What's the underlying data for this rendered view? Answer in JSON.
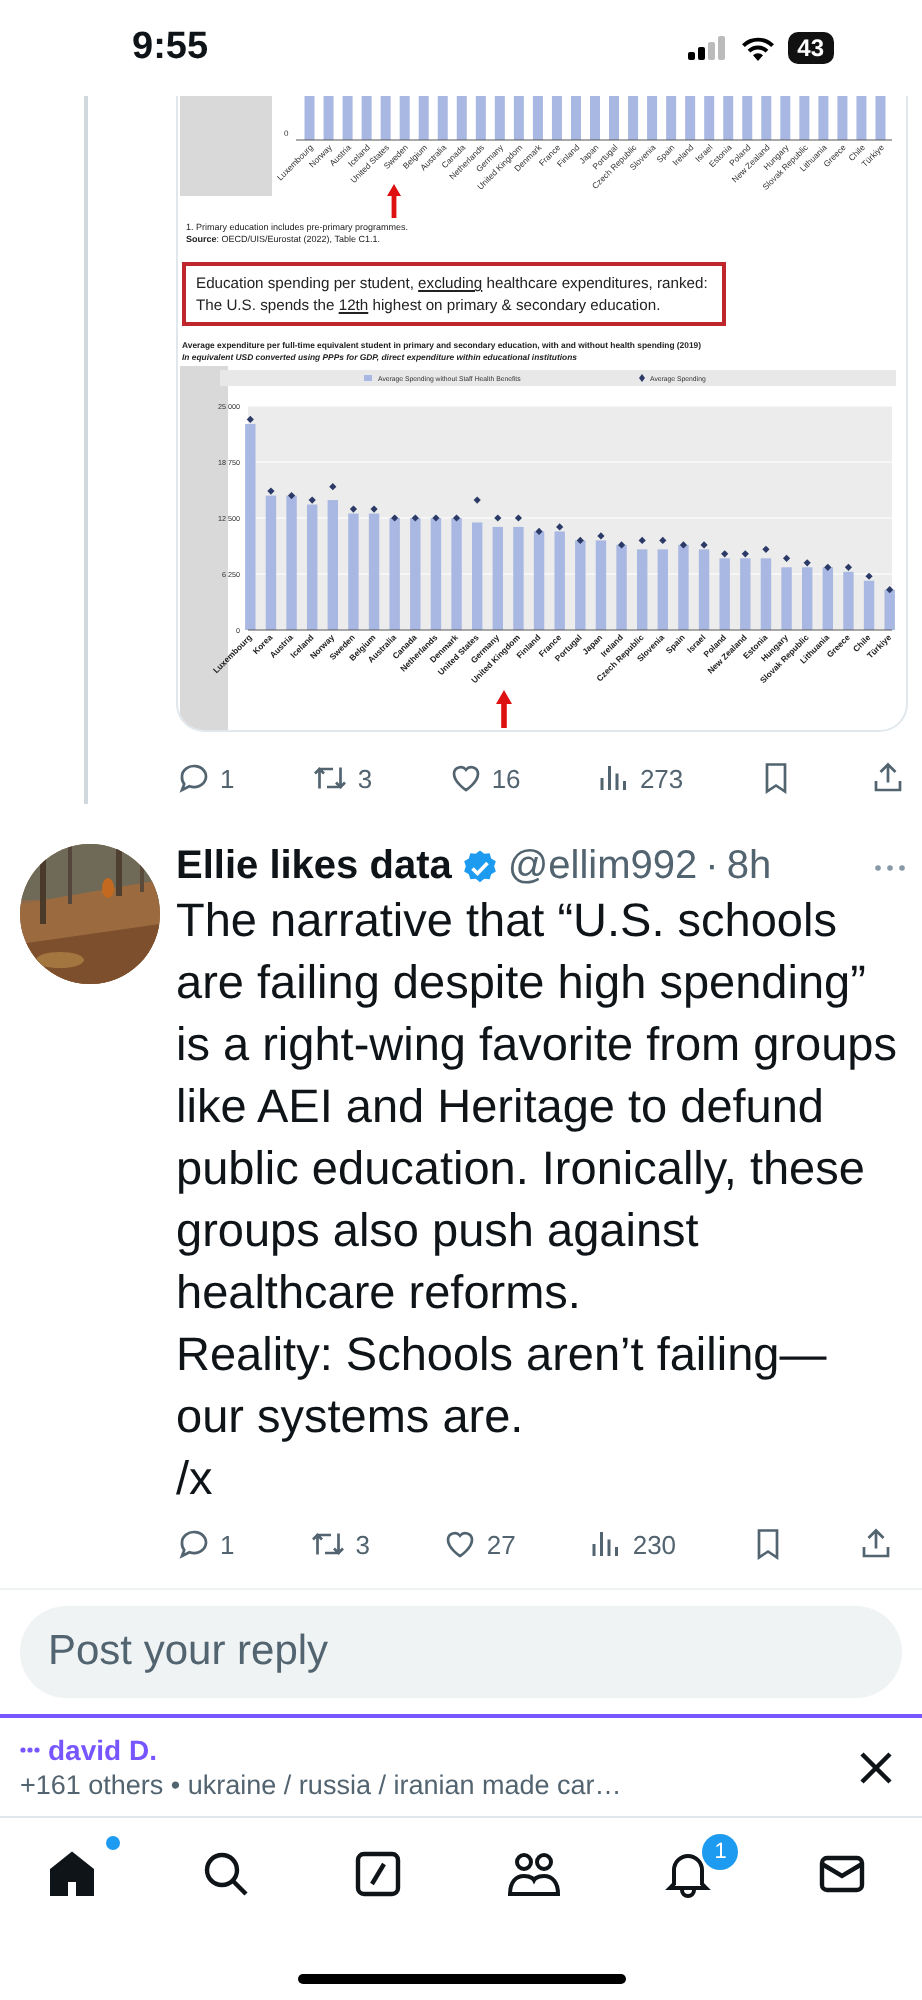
{
  "status_bar": {
    "time": "9:55",
    "battery": "43"
  },
  "quoted_image": {
    "top_chart": {
      "tick": "0",
      "labels": [
        "Luxembourg",
        "Norway",
        "Austria",
        "Iceland",
        "United States",
        "Sweden",
        "Belgium",
        "Australia",
        "Canada",
        "Netherlands",
        "Germany",
        "United Kingdom",
        "Denmark",
        "France",
        "Finland",
        "Japan",
        "Portugal",
        "Czech Republic",
        "Slovenia",
        "Spain",
        "Ireland",
        "Israel",
        "Estonia",
        "Poland",
        "New Zealand",
        "Hungary",
        "Slovak Republic",
        "Lithuania",
        "Greece",
        "Chile",
        "Türkiye"
      ]
    },
    "footnotes": [
      "1. Primary education includes pre-primary programmes.",
      "**Source**: OECD/UIS/Eurostat (2022), Table C1.1."
    ],
    "callout": [
      [
        {
          "text": "Education spending per student, ",
          "underline": false
        },
        {
          "text": "excluding",
          "underline": true
        },
        {
          "text": " healthcare expenditures, ranked:",
          "underline": false
        }
      ],
      [
        {
          "text": "The U.S. spends the ",
          "underline": false
        },
        {
          "text": "12th",
          "underline": true
        },
        {
          "text": " highest on primary & secondary education.",
          "underline": false
        }
      ]
    ],
    "chart_title": "Average expenditure per full-time equivalent student in primary and secondary education, with and without health spending (2019)",
    "chart_subtitle": "In equivalent USD converted using PPPs for GDP, direct expenditure within educational institutions",
    "chart_data": {
      "type": "bar",
      "stacked": false,
      "grid": true,
      "legend": "top",
      "ylim": [
        0,
        25000
      ],
      "yticks": [
        {
          "value": 0,
          "label": "0"
        },
        {
          "value": 6250,
          "label": "6 250"
        },
        {
          "value": 12500,
          "label": "12 500"
        },
        {
          "value": 18750,
          "label": "18 750"
        },
        {
          "value": 25000,
          "label": "25 000"
        }
      ],
      "categories": [
        "Luxembourg",
        "Korea",
        "Austria",
        "Iceland",
        "Norway",
        "Sweden",
        "Belgium",
        "Australia",
        "Canada",
        "Netherlands",
        "Denmark",
        "United States",
        "Germany",
        "United Kingdom",
        "Finland",
        "France",
        "Portugal",
        "Japan",
        "Ireland",
        "Czech Republic",
        "Slovenia",
        "Spain",
        "Israel",
        "Poland",
        "New Zealand",
        "Estonia",
        "Hungary",
        "Slovak Republic",
        "Lithuania",
        "Greece",
        "Chile",
        "Türkiye"
      ],
      "series": [
        {
          "name": "Average Spending without Staff Health Benefits",
          "type": "bar",
          "color": "#a9b8e2",
          "values": [
            23000,
            15000,
            15000,
            14000,
            14500,
            13000,
            13000,
            12500,
            12500,
            12500,
            12500,
            12000,
            11500,
            11500,
            11000,
            11000,
            10000,
            10000,
            9500,
            9000,
            9000,
            9500,
            9000,
            8000,
            8000,
            8000,
            7000,
            7000,
            7000,
            6500,
            5500,
            4500
          ]
        },
        {
          "name": "Average Spending",
          "type": "scatter",
          "color": "#2b3a67",
          "values": [
            23500,
            15500,
            15000,
            14500,
            16000,
            13500,
            13500,
            12500,
            12500,
            12500,
            12500,
            14500,
            12500,
            12500,
            11000,
            11500,
            10000,
            10500,
            9500,
            10000,
            10000,
            9500,
            9500,
            8500,
            8500,
            9000,
            8000,
            7500,
            7000,
            7000,
            6000,
            4500
          ]
        }
      ]
    }
  },
  "thread_actions": [
    {
      "kind": "reply",
      "count": "1"
    },
    {
      "kind": "repost",
      "count": "3"
    },
    {
      "kind": "like",
      "count": "16"
    },
    {
      "kind": "views",
      "count": "273"
    },
    {
      "kind": "bookmark"
    },
    {
      "kind": "share"
    }
  ],
  "post": {
    "name": "Ellie likes data",
    "verified": true,
    "handle": "@ellim992",
    "separator": "·",
    "time": "8h",
    "body": "The narrative that “U.S. schools are failing despite high spending” is a right-wing favorite from groups like AEI and Heritage to defund public education. Ironically, these groups also push against healthcare reforms.\nReality: Schools aren’t failing— our systems are.\n/x",
    "actions": [
      {
        "kind": "reply",
        "count": "1"
      },
      {
        "kind": "repost",
        "count": "3"
      },
      {
        "kind": "like",
        "count": "27"
      },
      {
        "kind": "views",
        "count": "230"
      },
      {
        "kind": "bookmark"
      },
      {
        "kind": "share"
      }
    ]
  },
  "reply_field": {
    "placeholder": "Post your reply"
  },
  "notification": {
    "name": "david D.",
    "text": "+161 others • ukraine / russia / iranian made car…"
  },
  "tabs": [
    {
      "kind": "home",
      "selected": true,
      "dot": true
    },
    {
      "kind": "search",
      "selected": false
    },
    {
      "kind": "grok",
      "selected": false
    },
    {
      "kind": "communities",
      "selected": false
    },
    {
      "kind": "notifications",
      "selected": false,
      "badge": "1"
    },
    {
      "kind": "messages",
      "selected": false
    }
  ]
}
